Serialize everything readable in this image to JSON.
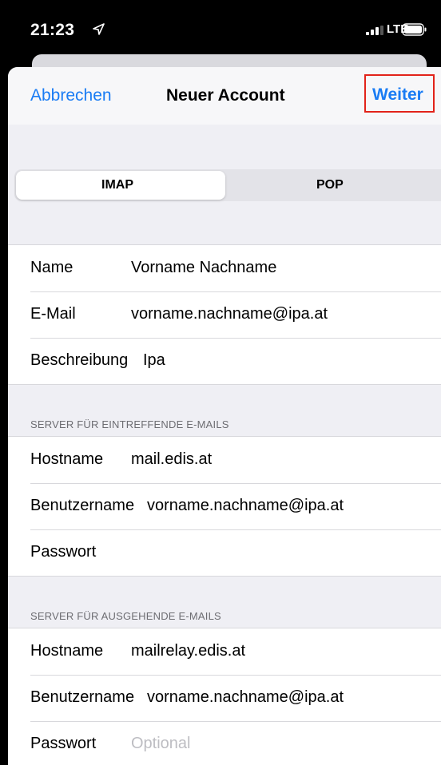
{
  "status_bar": {
    "time": "21:23",
    "network": "LTE"
  },
  "nav": {
    "cancel_label": "Abbrechen",
    "title": "Neuer Account",
    "next_label": "Weiter",
    "accent_color": "#1a7cf4",
    "highlight_color": "#e2231a"
  },
  "segmented": {
    "options": [
      "IMAP",
      "POP"
    ],
    "selected": "IMAP"
  },
  "account": {
    "rows": [
      {
        "label": "Name",
        "value": "Vorname Nachname"
      },
      {
        "label": "E-Mail",
        "value": "vorname.nachname@ipa.at"
      },
      {
        "label": "Beschreibung",
        "value": "Ipa"
      }
    ]
  },
  "incoming": {
    "header": "SERVER FÜR EINTREFFENDE E-MAILS",
    "rows": [
      {
        "label": "Hostname",
        "value": "mail.edis.at"
      },
      {
        "label": "Benutzername",
        "value": "vorname.nachname@ipa.at"
      },
      {
        "label": "Passwort",
        "value": ""
      }
    ]
  },
  "outgoing": {
    "header": "SERVER FÜR AUSGEHENDE E-MAILS",
    "rows": [
      {
        "label": "Hostname",
        "value": "mailrelay.edis.at"
      },
      {
        "label": "Benutzername",
        "value": "vorname.nachname@ipa.at"
      },
      {
        "label": "Passwort",
        "placeholder": "Optional"
      }
    ]
  }
}
